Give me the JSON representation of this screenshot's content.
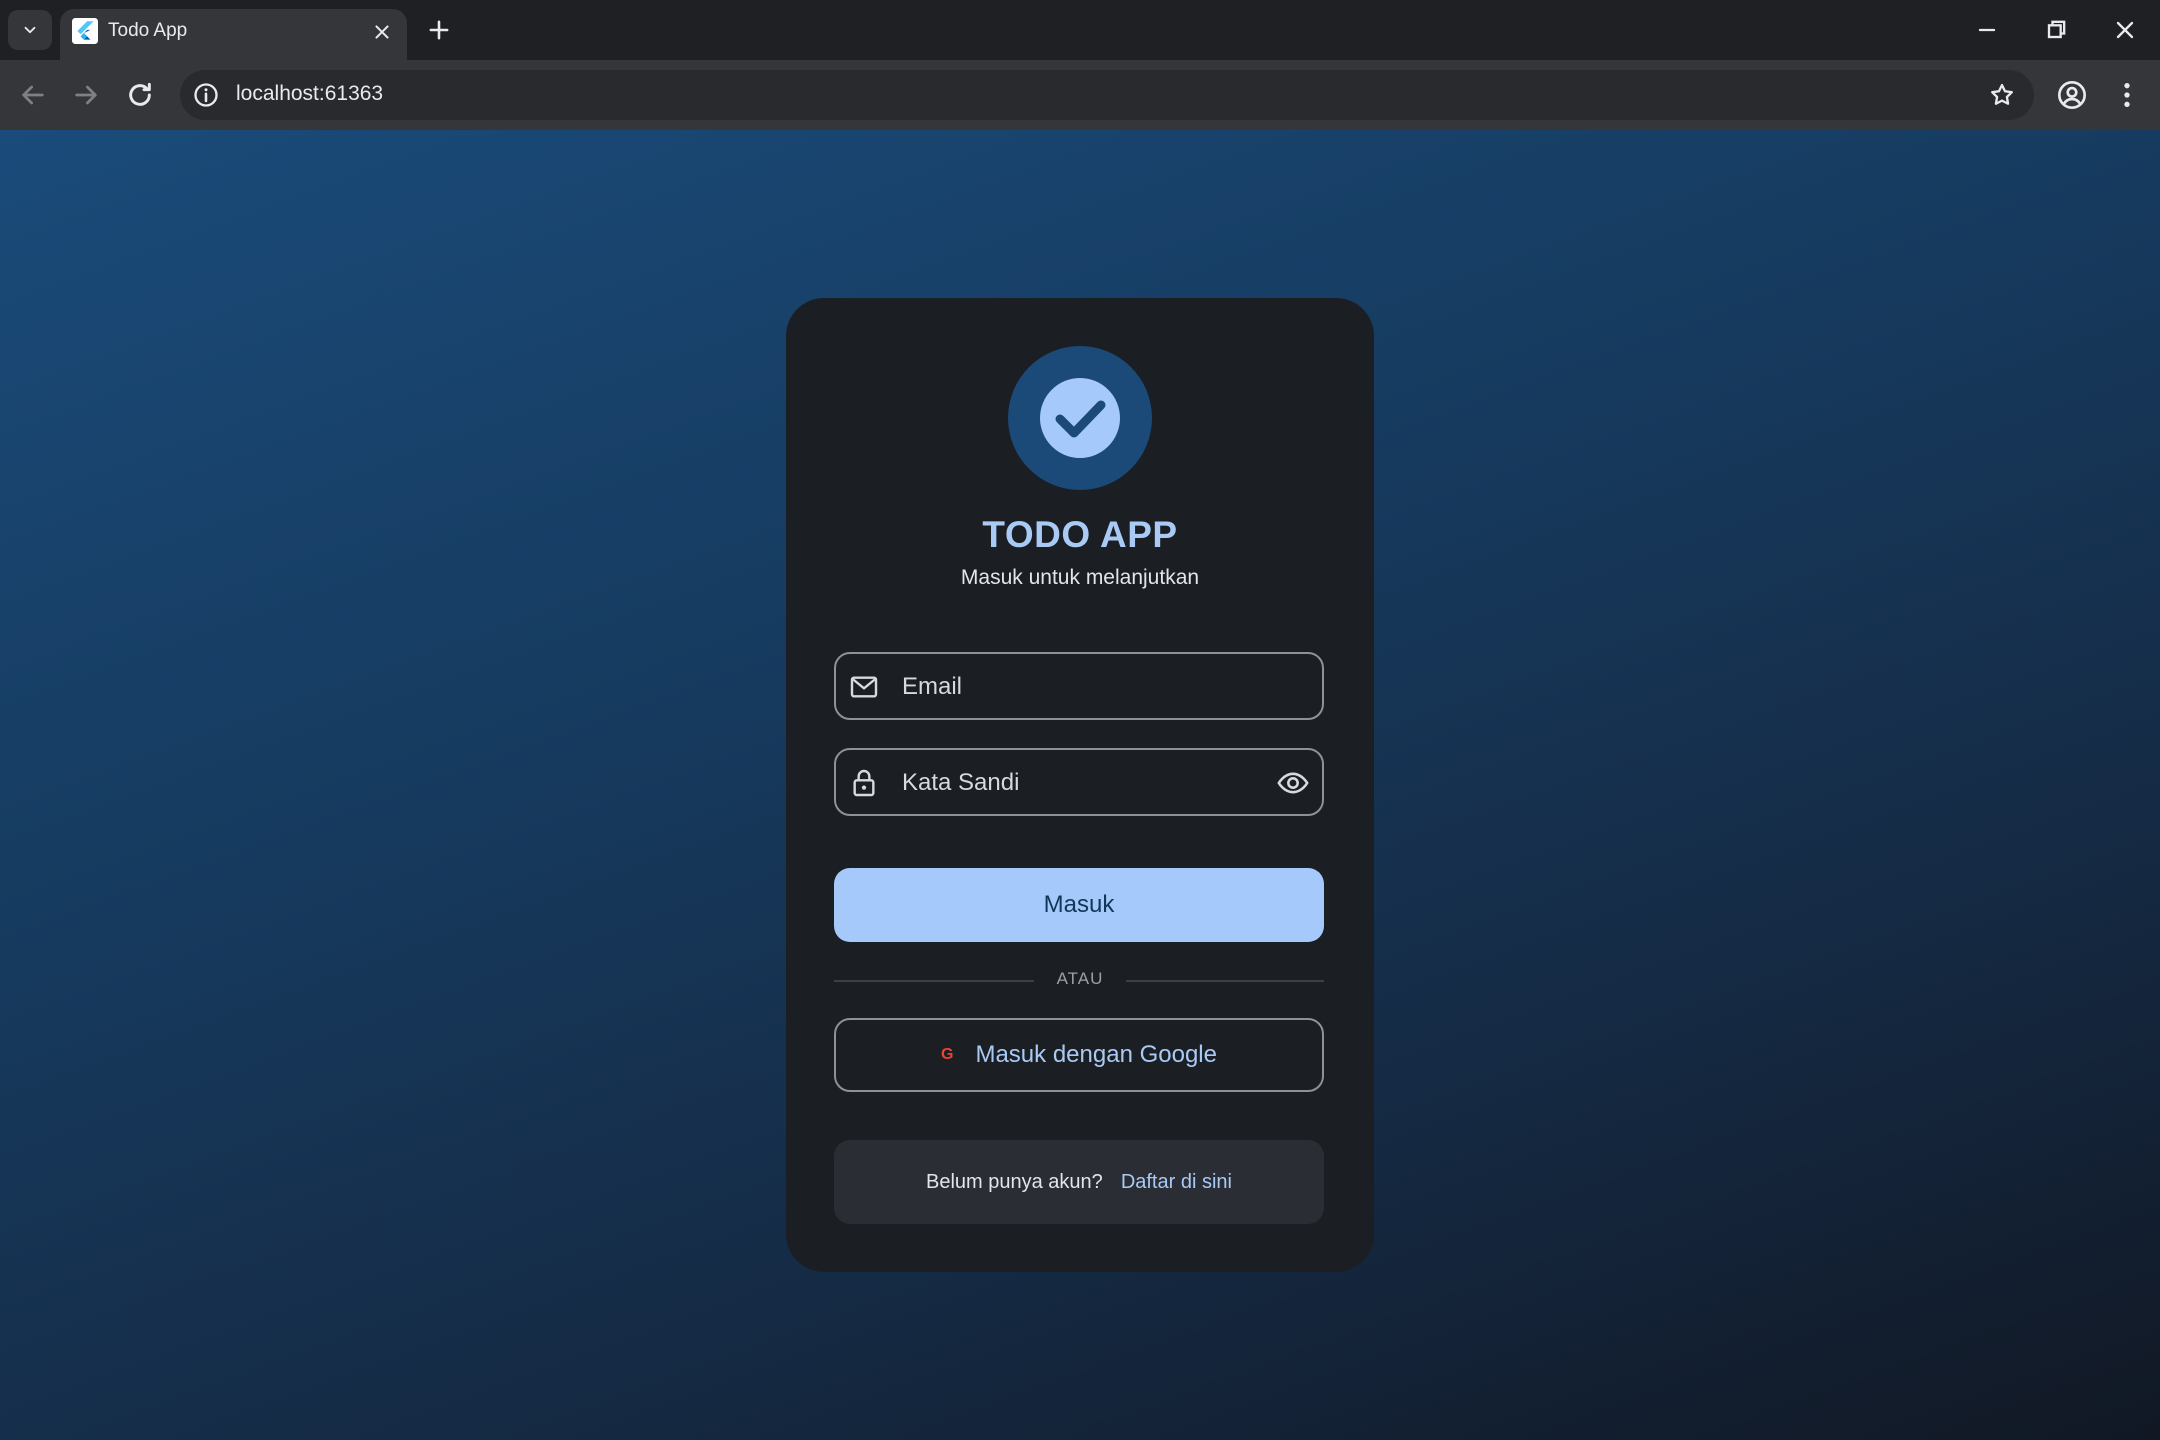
{
  "browser": {
    "tab_title": "Todo App",
    "url": "localhost:61363"
  },
  "login": {
    "app_title": "TODO APP",
    "subtitle": "Masuk untuk melanjutkan",
    "email_placeholder": "Email",
    "password_placeholder": "Kata Sandi",
    "submit_label": "Masuk",
    "divider_text": "ATAU",
    "google_icon_letter": "G",
    "google_label": "Masuk dengan Google",
    "signup_prompt": "Belum punya akun?",
    "signup_link": "Daftar di sini"
  },
  "colors": {
    "accent": "#a6c9fb",
    "card_bg": "#1b1e23",
    "logo_bg": "#1b4a78",
    "google_red": "#ea4335"
  },
  "icons": [
    "tab-search-icon",
    "flutter-favicon-icon",
    "close-icon",
    "plus-icon",
    "minimize-icon",
    "restore-icon",
    "back-arrow-icon",
    "forward-arrow-icon",
    "reload-icon",
    "info-icon",
    "star-icon",
    "profile-icon",
    "menu-dots-icon",
    "check-circle-icon",
    "mail-icon",
    "lock-icon",
    "eye-icon",
    "google-icon"
  ]
}
